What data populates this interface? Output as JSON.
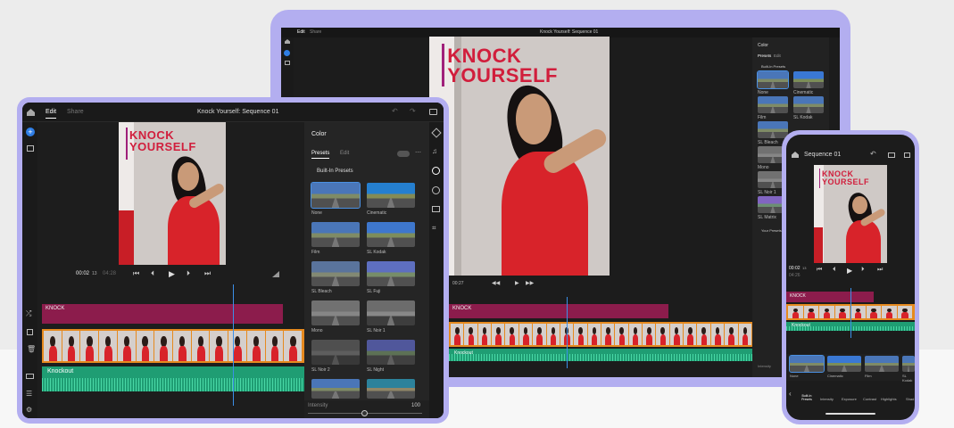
{
  "laptop": {
    "tabs": [
      "Edit",
      "Share"
    ],
    "sequence_title": "Knock Yourself: Sequence 01",
    "panel_title": "Color",
    "panel_tabs": [
      "Presets",
      "Edit"
    ],
    "section": "Built-In Presets",
    "presets": [
      "None",
      "Cinematic",
      "Film",
      "SL Kodak",
      "SL Bleach",
      "SL Fuji",
      "Mono",
      "SL Noir 1",
      "SL Noir 2",
      "SL Matrix"
    ],
    "your_presets": "Your Presets",
    "intensity_label": "Intensity",
    "video_title": [
      "KNOCK",
      "YOURSELF"
    ],
    "timecode": "00:27",
    "clip_title": "KNOCK",
    "audio_title": "Knockout"
  },
  "tablet": {
    "tabs": [
      "Edit",
      "Share"
    ],
    "sequence_title": "Knock Yourself: Sequence 01",
    "panel_title": "Color",
    "panel_tabs": [
      "Presets",
      "Edit"
    ],
    "section": "Built-In Presets",
    "presets": [
      "None",
      "Cinematic",
      "Film",
      "SL Kodak",
      "SL Bleach",
      "SL Fuji",
      "Mono",
      "SL Noir 1",
      "SL Noir 2",
      "SL Night"
    ],
    "intensity_label": "Intensity",
    "intensity_value": "100",
    "video_title": [
      "KNOCK",
      "YOURSELF"
    ],
    "time_current": "00:02",
    "time_frames": "13",
    "time_total": "04:28",
    "clip_title": "KNOCK",
    "audio_title": "Knockout"
  },
  "phone": {
    "sequence_title": "Sequence 01",
    "video_title": [
      "KNOCK",
      "YOURSELF"
    ],
    "time_current": "00:02",
    "time_frames": "13",
    "time_total": "04:26",
    "clip_title": "KNOCK",
    "audio_title": "Knockout",
    "presets": [
      "None",
      "Cinematic",
      "Film",
      "SL Kodak"
    ],
    "tools": [
      "Built-In Presets",
      "Intensity",
      "Exposure",
      "Contrast",
      "Highlights",
      "Shad"
    ]
  },
  "colors": {
    "device_frame": "#b3aef0",
    "accent_blue": "#2f7ee6",
    "title_red": "#d11e3c",
    "clip_bar": "#8c1c4c",
    "audio_green": "#1f9d73",
    "filmstrip_orange": "#e68a1f"
  }
}
